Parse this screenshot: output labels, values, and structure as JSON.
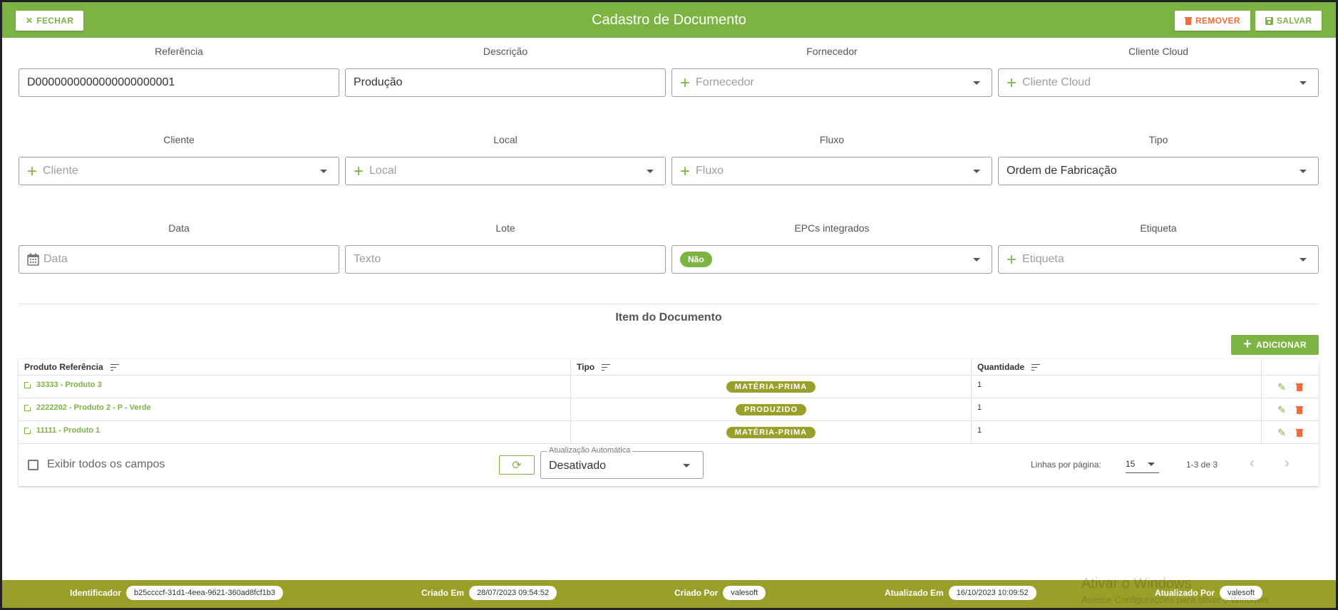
{
  "header": {
    "title": "Cadastro de Documento",
    "close_label": "FECHAR",
    "remove_label": "REMOVER",
    "save_label": "SALVAR"
  },
  "form": {
    "referencia": {
      "label": "Referência",
      "value": "D0000000000000000000001"
    },
    "descricao": {
      "label": "Descrição",
      "value": "Produção"
    },
    "fornecedor": {
      "label": "Fornecedor",
      "placeholder": "Fornecedor"
    },
    "cliente_cloud": {
      "label": "Cliente Cloud",
      "placeholder": "Cliente Cloud"
    },
    "cliente": {
      "label": "Cliente",
      "placeholder": "Cliente"
    },
    "local": {
      "label": "Local",
      "placeholder": "Local"
    },
    "fluxo": {
      "label": "Fluxo",
      "placeholder": "Fluxo"
    },
    "tipo": {
      "label": "Tipo",
      "value": "Ordem de Fabricação"
    },
    "data": {
      "label": "Data",
      "placeholder": "Data"
    },
    "lote": {
      "label": "Lote",
      "placeholder": "Texto"
    },
    "epcs": {
      "label": "EPCs integrados",
      "value": "Não"
    },
    "etiqueta": {
      "label": "Etiqueta",
      "placeholder": "Etiqueta"
    }
  },
  "items": {
    "title": "Item do Documento",
    "add_label": "ADICIONAR",
    "columns": [
      "Produto Referência",
      "Tipo",
      "Quantidade"
    ],
    "rows": [
      {
        "produto": "33333 - Produto 3",
        "tipo": "MATÉRIA-PRIMA",
        "quantidade": "1"
      },
      {
        "produto": "2222202 - Produto 2 - P - Verde",
        "tipo": "PRODUZIDO",
        "quantidade": "1"
      },
      {
        "produto": "11111 - Produto 1",
        "tipo": "MATÉRIA-PRIMA",
        "quantidade": "1"
      }
    ],
    "footer": {
      "show_all_label": "Exibir todos os campos",
      "auto_update_legend": "Atualização Automática",
      "auto_update_value": "Desativado",
      "rows_per_page_label": "Linhas por página:",
      "rows_per_page_value": "15",
      "range": "1-3 de 3"
    }
  },
  "statusbar": {
    "identificador_label": "Identificador",
    "identificador": "b25ccccf-31d1-4eea-9621-360ad8fcf1b3",
    "criado_em_label": "Criado Em",
    "criado_em": "28/07/2023 09:54:52",
    "criado_por_label": "Criado Por",
    "criado_por": "valesoft",
    "atualizado_em_label": "Atualizado Em",
    "atualizado_em": "16/10/2023 10:09:52",
    "atualizado_por_label": "Atualizado Por",
    "atualizado_por": "valesoft"
  },
  "watermark": {
    "line1": "Ativar o Windows",
    "line2": "Acesse Configurações para ativar o Windows."
  },
  "colors": {
    "primary": "#7cb342",
    "olive": "#9a9f2a",
    "danger": "#f26b3a"
  }
}
